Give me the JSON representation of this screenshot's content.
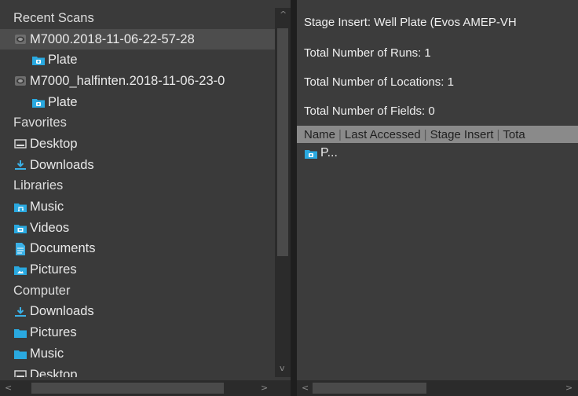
{
  "tree": {
    "sections": [
      {
        "label": "Recent Scans",
        "items": [
          {
            "label": "M7000.2018-11-06-22-57-28",
            "icon": "scanner-icon",
            "level": 0,
            "selected": true
          },
          {
            "label": "Plate",
            "icon": "plate-folder-icon",
            "level": 1
          },
          {
            "label": "M7000_halfinten.2018-11-06-23-0",
            "icon": "scanner-icon",
            "level": 0
          },
          {
            "label": "Plate",
            "icon": "plate-folder-icon",
            "level": 1
          }
        ]
      },
      {
        "label": "Favorites",
        "items": [
          {
            "label": "Desktop",
            "icon": "desktop-icon",
            "level": 0
          },
          {
            "label": "Downloads",
            "icon": "downloads-icon",
            "level": 0
          }
        ]
      },
      {
        "label": "Libraries",
        "items": [
          {
            "label": "Music",
            "icon": "music-folder-icon",
            "level": 0
          },
          {
            "label": "Videos",
            "icon": "videos-folder-icon",
            "level": 0
          },
          {
            "label": "Documents",
            "icon": "documents-icon",
            "level": 0
          },
          {
            "label": "Pictures",
            "icon": "pictures-folder-icon",
            "level": 0
          }
        ]
      },
      {
        "label": "Computer",
        "items": [
          {
            "label": "Downloads",
            "icon": "downloads-icon",
            "level": 0
          },
          {
            "label": "Pictures",
            "icon": "folder-icon",
            "level": 0
          },
          {
            "label": "Music",
            "icon": "folder-icon",
            "level": 0
          },
          {
            "label": "Desktop",
            "icon": "desktop-icon",
            "level": 0
          }
        ]
      }
    ]
  },
  "details": {
    "stage_insert": "Stage Insert:  Well Plate (Evos AMEP-VH",
    "total_runs": "Total Number of Runs:  1",
    "total_locations": "Total Number of Locations:  1",
    "total_fields": "Total Number of Fields:  0"
  },
  "list": {
    "columns": [
      "Name",
      "Last Accessed",
      "Stage Insert",
      "Tota"
    ],
    "rows": [
      {
        "name": "P...",
        "icon": "plate-folder-icon"
      }
    ]
  },
  "scroll": {
    "up_arrow": "^",
    "down_arrow": "v",
    "left_arrow": "<",
    "right_arrow": ">"
  },
  "colors": {
    "folder": "#2aa9e0",
    "accent": "#3ab0e6"
  }
}
